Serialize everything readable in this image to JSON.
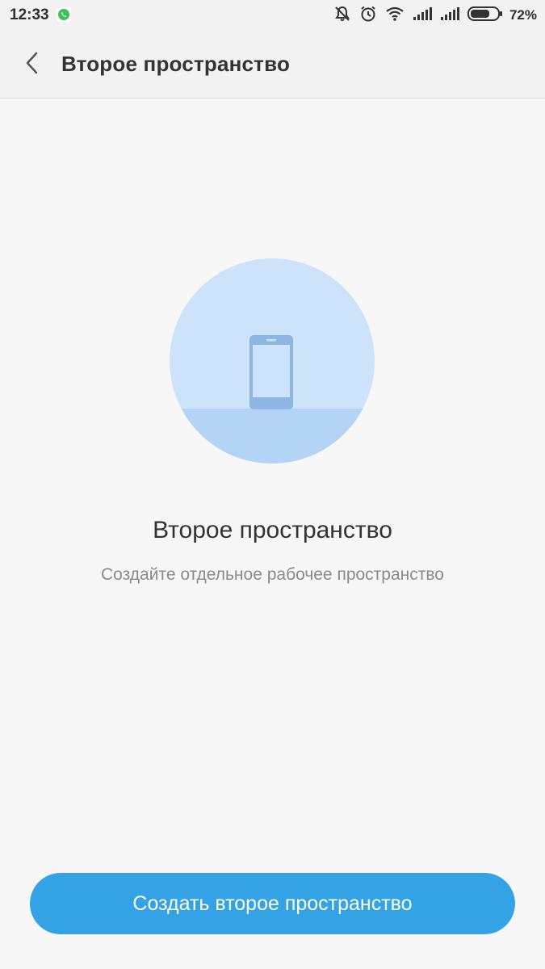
{
  "status_bar": {
    "time": "12:33",
    "battery_percent": "72%",
    "battery_level": 0.72,
    "icons": [
      "whatsapp-icon",
      "mute-icon",
      "alarm-icon",
      "wifi-icon",
      "signal-icon",
      "signal-icon",
      "battery-icon"
    ]
  },
  "header": {
    "title": "Второе пространство",
    "back_icon": "chevron-left-icon"
  },
  "main": {
    "title": "Второе пространство",
    "subtitle": "Создайте отдельное рабочее пространство",
    "illustration_icon": "phone-icon"
  },
  "actions": {
    "create_label": "Создать второе пространство"
  },
  "colors": {
    "accent": "#34a3e6",
    "circle_light": "#cce3fa",
    "circle_dark": "#b3d4f5",
    "phone": "#8eb6e3"
  }
}
